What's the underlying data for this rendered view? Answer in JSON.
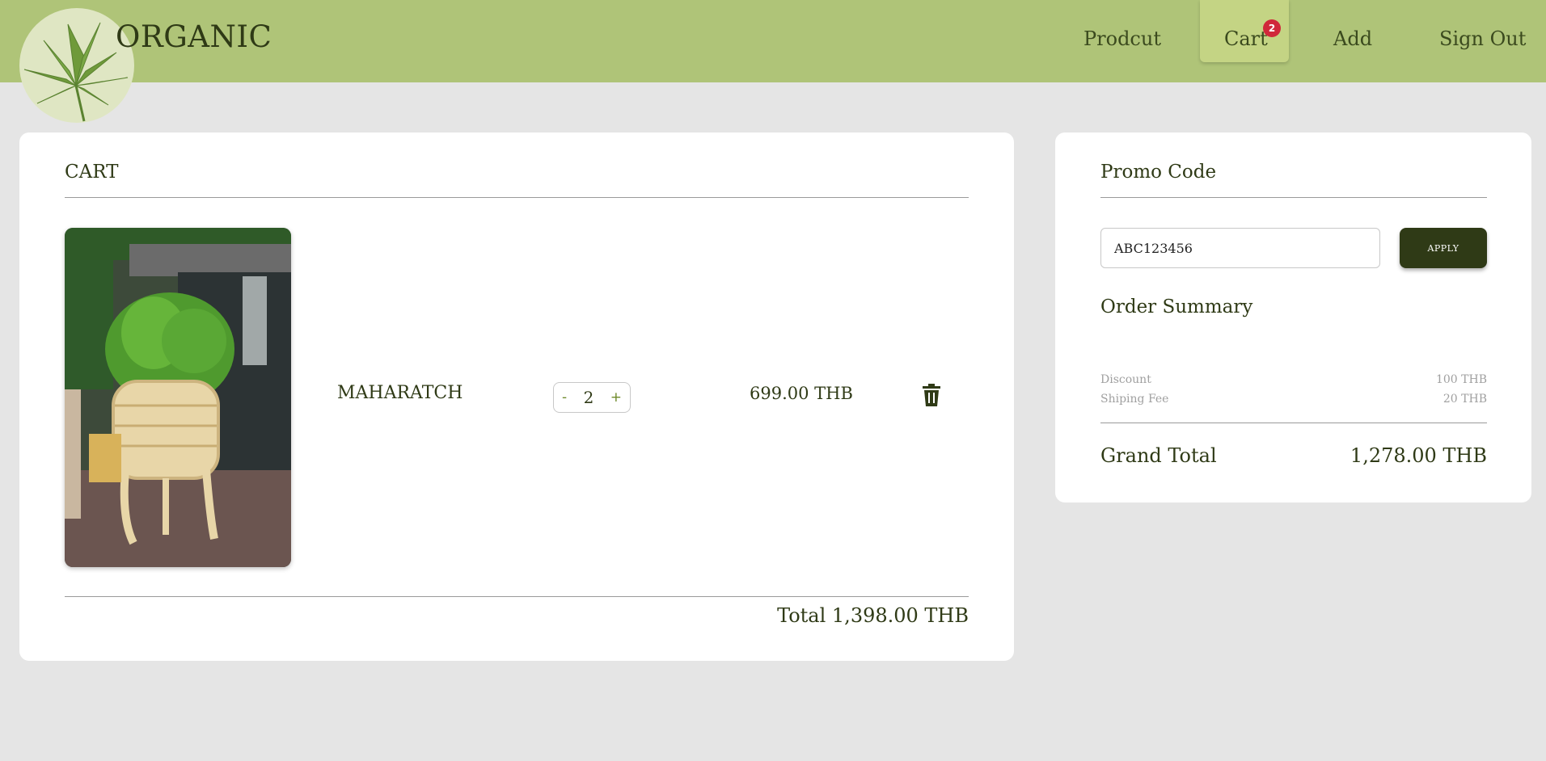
{
  "header": {
    "brand": "ORGANIC",
    "nav": {
      "product": "Prodcut",
      "cart": "Cart",
      "cart_count": "2",
      "add": "Add",
      "sign_out": "Sign Out"
    }
  },
  "cart": {
    "title": "CART",
    "items": [
      {
        "name": "MAHARATCH",
        "quantity": "2",
        "decrement_label": "-",
        "increment_label": "+",
        "price": "699.00 THB"
      }
    ],
    "total": "Total 1,398.00 THB"
  },
  "promo": {
    "title": "Promo Code",
    "code_value": "ABC123456",
    "apply_label": "APPLY"
  },
  "summary": {
    "title": "Order Summary",
    "discount_label": "Discount",
    "discount_value": "100 THB",
    "shipping_label": "Shiping Fee",
    "shipping_value": "20 THB",
    "grand_total_label": "Grand Total",
    "grand_total_value": "1,278.00 THB"
  },
  "colors": {
    "header_bg": "#afc478",
    "active_tab": "#c4d484",
    "dark_green": "#2f3a16",
    "badge_red": "#d0283a"
  },
  "icons": [
    "cannabis-leaf-logo-icon",
    "trash-icon"
  ]
}
